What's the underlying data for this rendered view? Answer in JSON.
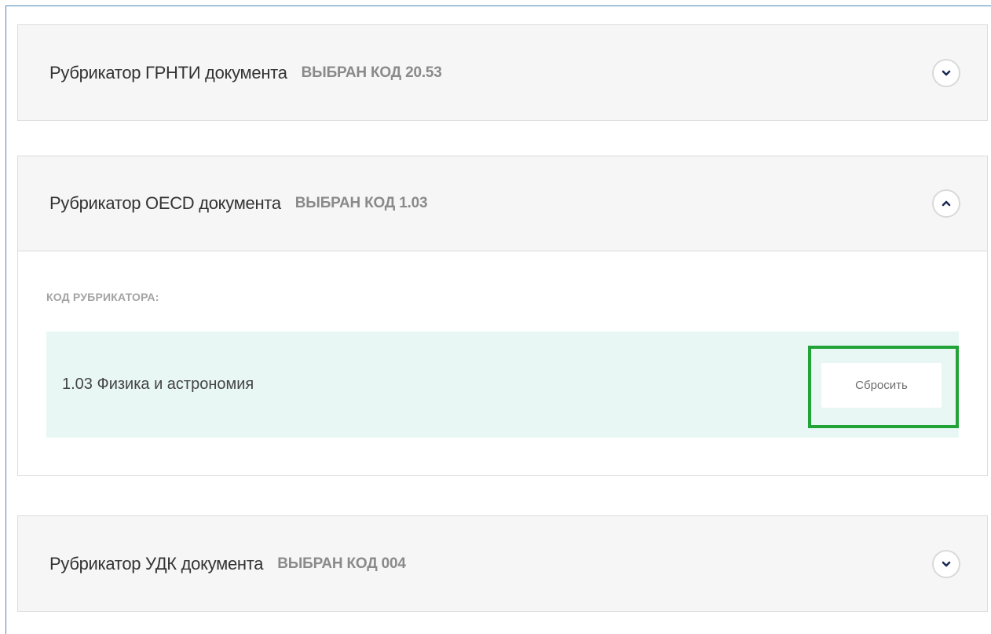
{
  "panels": {
    "grnti": {
      "title": "Рубрикатор ГРНТИ документа",
      "code": "ВЫБРАН КОД 20.53",
      "toggle_icon": "chevron-down-icon"
    },
    "oecd": {
      "title": "Рубрикатор OECD документа",
      "code": "ВЫБРАН КОД 1.03",
      "toggle_icon": "chevron-up-icon",
      "body": {
        "field_label": "КОД РУБРИКАТОРА:",
        "selected_value": "1.03 Физика и астрономия",
        "reset_label": "Сбросить"
      }
    },
    "udk": {
      "title": "Рубрикатор УДК документа",
      "code": "ВЫБРАН КОД 004",
      "toggle_icon": "chevron-down-icon"
    }
  },
  "colors": {
    "highlight": "#22a338",
    "selected_bg": "#e8f7f4",
    "header_bg": "#f6f6f6",
    "frame_border": "#4b86b8"
  }
}
